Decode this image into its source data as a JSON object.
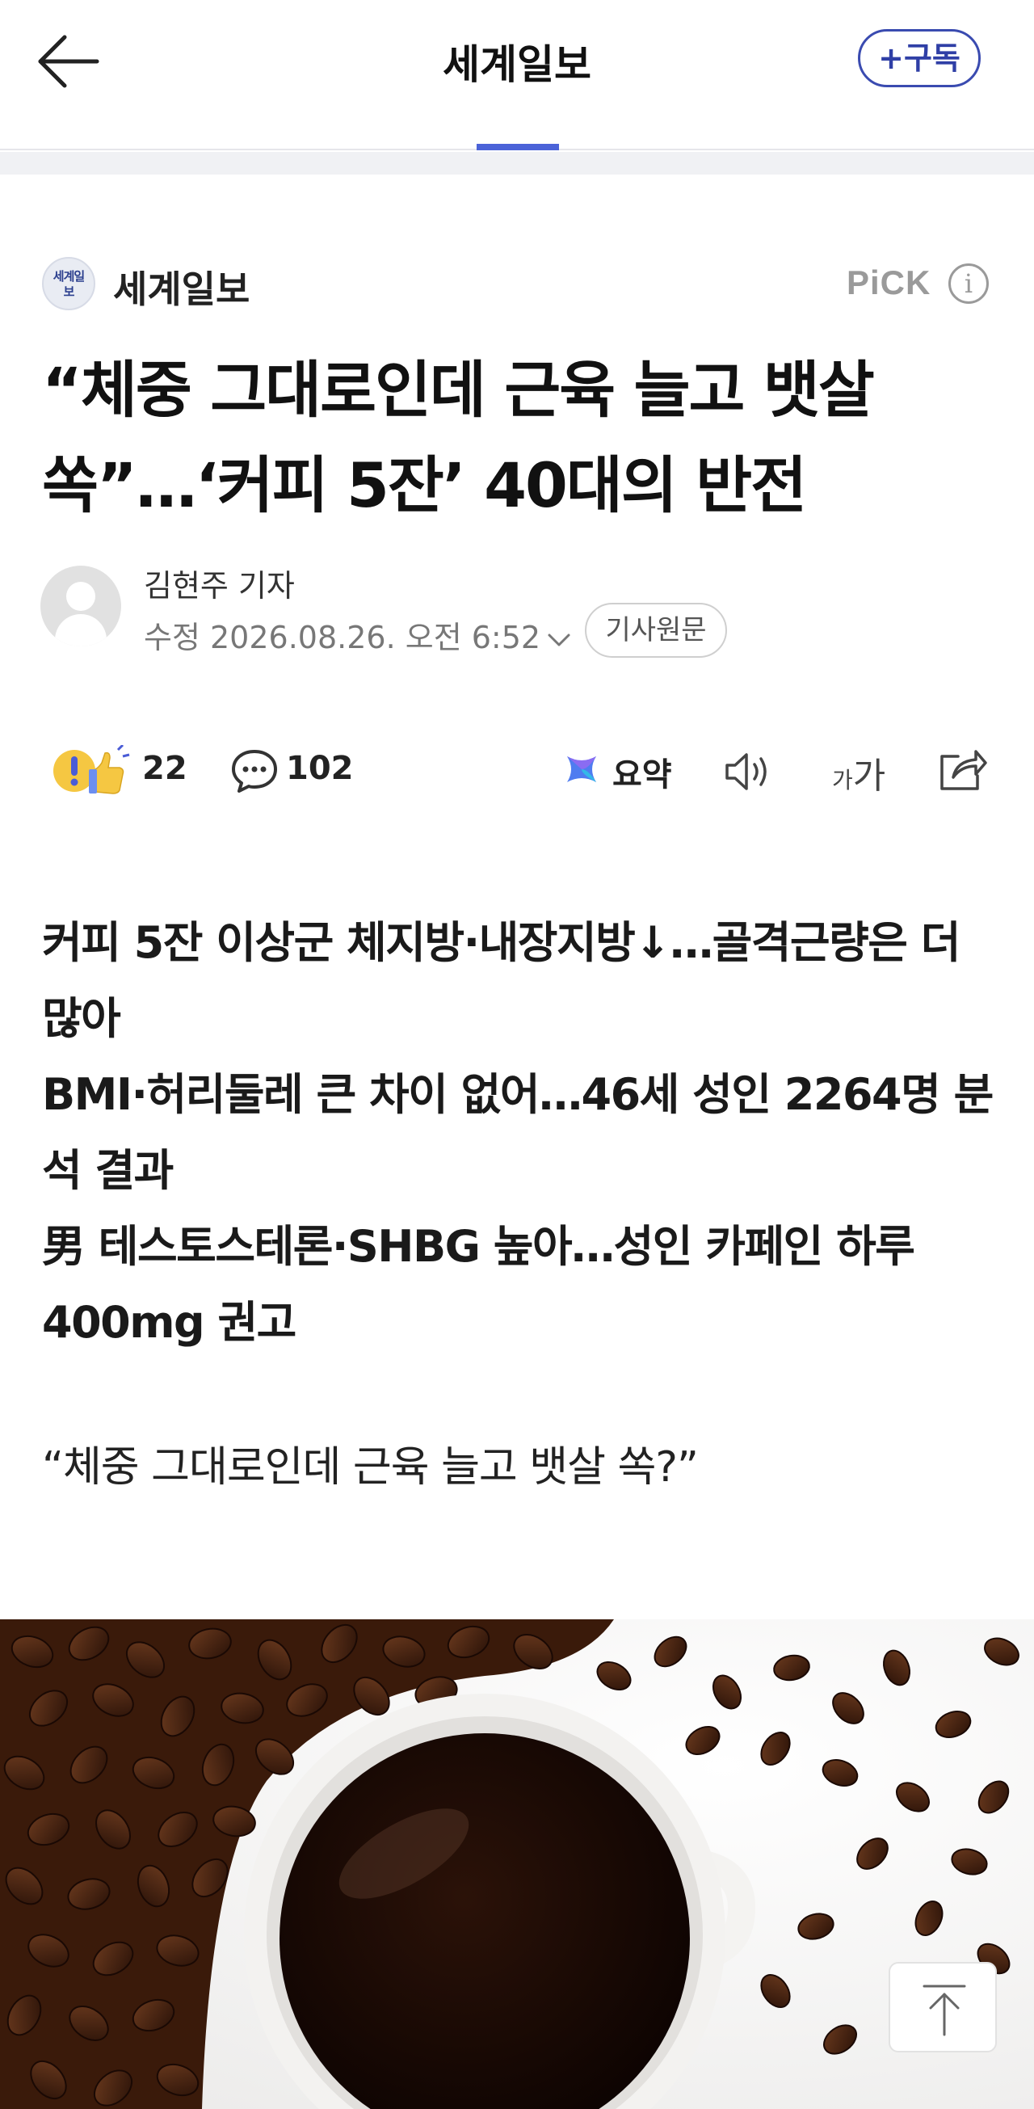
{
  "header": {
    "title": "세계일보",
    "subscribe_label": "+구독"
  },
  "press": {
    "logo_text": "세계일보",
    "name": "세계일보",
    "pick_label": "PiCK"
  },
  "article": {
    "headline_line1": "“체중 그대로인데 근육 늘고 뱃살",
    "headline_line2": "쏙”…‘커피 5잔’ 40대의 반전",
    "reporter": "김현주 기자",
    "modified": "수정 2026.08.26. 오전 6:52",
    "original_label": "기사원문"
  },
  "actions": {
    "reaction_count": "22",
    "comment_count": "102",
    "summary_label": "요약",
    "font_small": "가",
    "font_big": "가"
  },
  "summary": {
    "line1": "커피 5잔 이상군 체지방·내장지방↓…골격근량은 더 많아",
    "line2": "BMI·허리둘레 큰 차이 없어…46세 성인 2264명 분석 결과",
    "line3": "男 테스토스테론·SHBG 높아…성인 카페인 하루 400mg 권고"
  },
  "body": {
    "quote": "“체중 그대로인데 근육 늘고 뱃살 쏙?”"
  },
  "colors": {
    "accent": "#4b63d8",
    "subscribe": "#2f3fa6",
    "muted": "#9a9a9a"
  },
  "icons": {
    "back": "back-arrow-icon",
    "info": "info-icon",
    "reaction": "reaction-emoji-icon",
    "comment": "comment-icon",
    "summary": "ai-summary-icon",
    "speaker": "speaker-icon",
    "font": "font-size-icon",
    "share": "share-icon",
    "top": "scroll-top-icon"
  }
}
